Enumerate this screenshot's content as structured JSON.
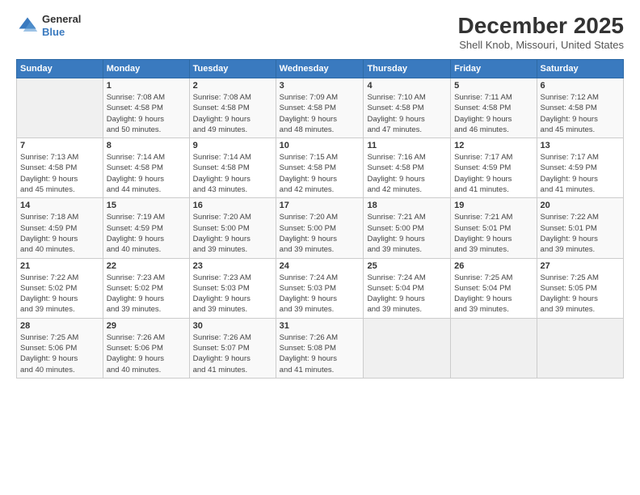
{
  "logo": {
    "general": "General",
    "blue": "Blue"
  },
  "header": {
    "month": "December 2025",
    "location": "Shell Knob, Missouri, United States"
  },
  "days_of_week": [
    "Sunday",
    "Monday",
    "Tuesday",
    "Wednesday",
    "Thursday",
    "Friday",
    "Saturday"
  ],
  "weeks": [
    [
      {
        "day": "",
        "info": ""
      },
      {
        "day": "1",
        "info": "Sunrise: 7:08 AM\nSunset: 4:58 PM\nDaylight: 9 hours\nand 50 minutes."
      },
      {
        "day": "2",
        "info": "Sunrise: 7:08 AM\nSunset: 4:58 PM\nDaylight: 9 hours\nand 49 minutes."
      },
      {
        "day": "3",
        "info": "Sunrise: 7:09 AM\nSunset: 4:58 PM\nDaylight: 9 hours\nand 48 minutes."
      },
      {
        "day": "4",
        "info": "Sunrise: 7:10 AM\nSunset: 4:58 PM\nDaylight: 9 hours\nand 47 minutes."
      },
      {
        "day": "5",
        "info": "Sunrise: 7:11 AM\nSunset: 4:58 PM\nDaylight: 9 hours\nand 46 minutes."
      },
      {
        "day": "6",
        "info": "Sunrise: 7:12 AM\nSunset: 4:58 PM\nDaylight: 9 hours\nand 45 minutes."
      }
    ],
    [
      {
        "day": "7",
        "info": "Sunrise: 7:13 AM\nSunset: 4:58 PM\nDaylight: 9 hours\nand 45 minutes."
      },
      {
        "day": "8",
        "info": "Sunrise: 7:14 AM\nSunset: 4:58 PM\nDaylight: 9 hours\nand 44 minutes."
      },
      {
        "day": "9",
        "info": "Sunrise: 7:14 AM\nSunset: 4:58 PM\nDaylight: 9 hours\nand 43 minutes."
      },
      {
        "day": "10",
        "info": "Sunrise: 7:15 AM\nSunset: 4:58 PM\nDaylight: 9 hours\nand 42 minutes."
      },
      {
        "day": "11",
        "info": "Sunrise: 7:16 AM\nSunset: 4:58 PM\nDaylight: 9 hours\nand 42 minutes."
      },
      {
        "day": "12",
        "info": "Sunrise: 7:17 AM\nSunset: 4:59 PM\nDaylight: 9 hours\nand 41 minutes."
      },
      {
        "day": "13",
        "info": "Sunrise: 7:17 AM\nSunset: 4:59 PM\nDaylight: 9 hours\nand 41 minutes."
      }
    ],
    [
      {
        "day": "14",
        "info": "Sunrise: 7:18 AM\nSunset: 4:59 PM\nDaylight: 9 hours\nand 40 minutes."
      },
      {
        "day": "15",
        "info": "Sunrise: 7:19 AM\nSunset: 4:59 PM\nDaylight: 9 hours\nand 40 minutes."
      },
      {
        "day": "16",
        "info": "Sunrise: 7:20 AM\nSunset: 5:00 PM\nDaylight: 9 hours\nand 39 minutes."
      },
      {
        "day": "17",
        "info": "Sunrise: 7:20 AM\nSunset: 5:00 PM\nDaylight: 9 hours\nand 39 minutes."
      },
      {
        "day": "18",
        "info": "Sunrise: 7:21 AM\nSunset: 5:00 PM\nDaylight: 9 hours\nand 39 minutes."
      },
      {
        "day": "19",
        "info": "Sunrise: 7:21 AM\nSunset: 5:01 PM\nDaylight: 9 hours\nand 39 minutes."
      },
      {
        "day": "20",
        "info": "Sunrise: 7:22 AM\nSunset: 5:01 PM\nDaylight: 9 hours\nand 39 minutes."
      }
    ],
    [
      {
        "day": "21",
        "info": "Sunrise: 7:22 AM\nSunset: 5:02 PM\nDaylight: 9 hours\nand 39 minutes."
      },
      {
        "day": "22",
        "info": "Sunrise: 7:23 AM\nSunset: 5:02 PM\nDaylight: 9 hours\nand 39 minutes."
      },
      {
        "day": "23",
        "info": "Sunrise: 7:23 AM\nSunset: 5:03 PM\nDaylight: 9 hours\nand 39 minutes."
      },
      {
        "day": "24",
        "info": "Sunrise: 7:24 AM\nSunset: 5:03 PM\nDaylight: 9 hours\nand 39 minutes."
      },
      {
        "day": "25",
        "info": "Sunrise: 7:24 AM\nSunset: 5:04 PM\nDaylight: 9 hours\nand 39 minutes."
      },
      {
        "day": "26",
        "info": "Sunrise: 7:25 AM\nSunset: 5:04 PM\nDaylight: 9 hours\nand 39 minutes."
      },
      {
        "day": "27",
        "info": "Sunrise: 7:25 AM\nSunset: 5:05 PM\nDaylight: 9 hours\nand 39 minutes."
      }
    ],
    [
      {
        "day": "28",
        "info": "Sunrise: 7:25 AM\nSunset: 5:06 PM\nDaylight: 9 hours\nand 40 minutes."
      },
      {
        "day": "29",
        "info": "Sunrise: 7:26 AM\nSunset: 5:06 PM\nDaylight: 9 hours\nand 40 minutes."
      },
      {
        "day": "30",
        "info": "Sunrise: 7:26 AM\nSunset: 5:07 PM\nDaylight: 9 hours\nand 41 minutes."
      },
      {
        "day": "31",
        "info": "Sunrise: 7:26 AM\nSunset: 5:08 PM\nDaylight: 9 hours\nand 41 minutes."
      },
      {
        "day": "",
        "info": ""
      },
      {
        "day": "",
        "info": ""
      },
      {
        "day": "",
        "info": ""
      }
    ]
  ]
}
